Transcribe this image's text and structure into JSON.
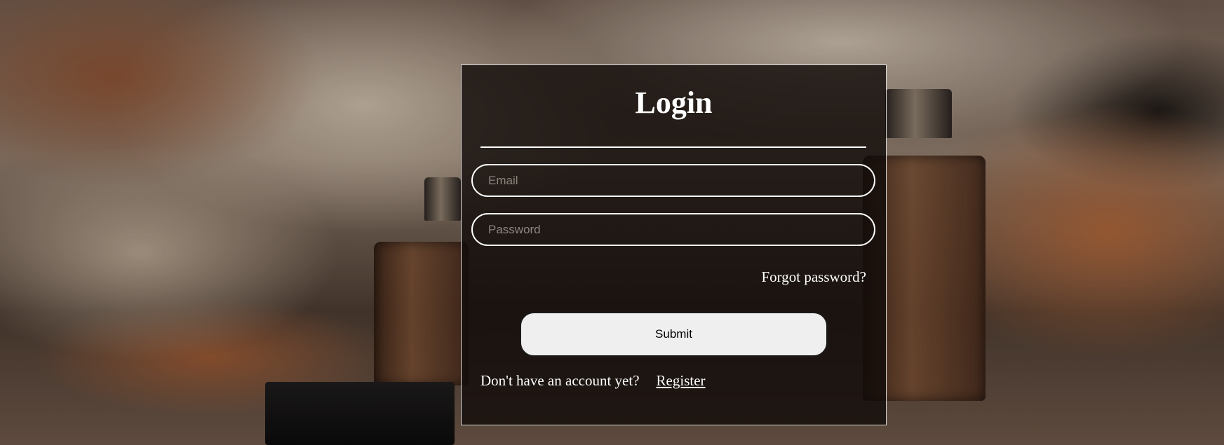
{
  "login": {
    "title": "Login",
    "email_placeholder": "Email",
    "password_placeholder": "Password",
    "forgot_label": "Forgot password?",
    "submit_label": "Submit",
    "no_account_text": "Don't have an account yet?",
    "register_label": "Register"
  },
  "colors": {
    "card_border": "#ffffff",
    "submit_bg": "#efefef",
    "text": "#ffffff"
  }
}
